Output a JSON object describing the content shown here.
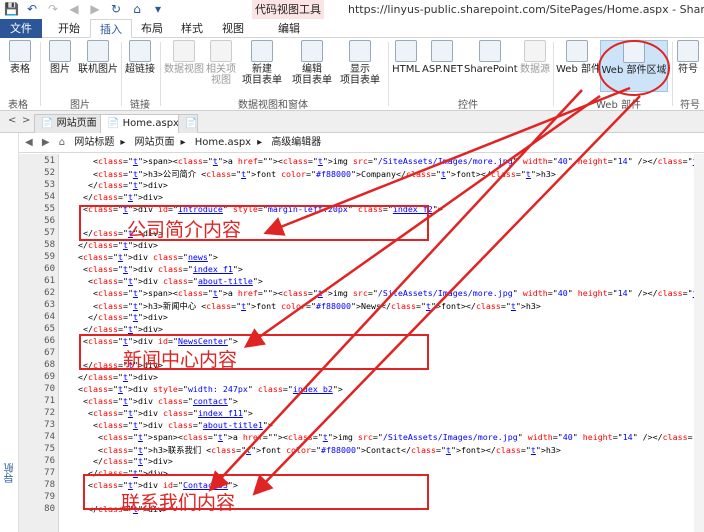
{
  "window": {
    "context_tab": "代码视图工具",
    "title": "https://linyus-public.sharepoint.com/SitePages/Home.aspx - SharePoint Designer"
  },
  "quick_access": [
    "save-icon",
    "undo-icon",
    "redo-icon",
    "back-icon",
    "forward-icon",
    "refresh-icon",
    "home-icon",
    "chevron-down-icon"
  ],
  "tabs": [
    "文件",
    "开始",
    "插入",
    "布局",
    "样式",
    "视图",
    "编辑"
  ],
  "ribbon": {
    "buttons": [
      "表格",
      "图片",
      "联机图片",
      "超链接",
      "数据视图",
      "相关项\n视图",
      "新建\n项目表单",
      "编辑\n项目表单",
      "显示\n项目表单",
      "HTML",
      "ASP.NET",
      "SharePoint",
      "数据源",
      "Web 部件",
      "Web 部件区域",
      "符号"
    ],
    "groups": [
      "表格",
      "图片",
      "链接",
      "数据视图和窗体",
      "控件",
      "Web 部件",
      "符号"
    ]
  },
  "doc_tabs": [
    "网站页面",
    "Home.aspx"
  ],
  "breadcrumb": [
    "网站标题",
    "网站页面",
    "Home.aspx",
    "高级编辑器"
  ],
  "nav_label": "导航",
  "code_lines": [
    {
      "n": "51",
      "t": "      <span><a href=\"\"><img src=\"/SiteAssets/Images/more.jpg\" width=\"40\" height=\"14\" /></a></span>"
    },
    {
      "n": "52",
      "t": "      <h3>公司简介 <font color=\"#f88000\">Company</font></h3>"
    },
    {
      "n": "53",
      "t": "     </div>"
    },
    {
      "n": "54",
      "t": "    </div>"
    },
    {
      "n": "55",
      "t": "    <div id=\"Introduce\" style=\"margin-left:20px\" class=\"index f2\">"
    },
    {
      "n": "56",
      "t": ""
    },
    {
      "n": "57",
      "t": "    </div>"
    },
    {
      "n": "58",
      "t": "   </div>"
    },
    {
      "n": "59",
      "t": "   <div class=\"news\">"
    },
    {
      "n": "60",
      "t": "    <div class=\"index f1\">"
    },
    {
      "n": "61",
      "t": "     <div class=\"about-title\">"
    },
    {
      "n": "62",
      "t": "      <span><a href=\"\"><img src=\"/SiteAssets/Images/more.jpg\" width=\"40\" height=\"14\" /></a></span>"
    },
    {
      "n": "63",
      "t": "      <h3>新闻中心 <font color=\"#f88000\">News</font></h3>"
    },
    {
      "n": "64",
      "t": "     </div>"
    },
    {
      "n": "65",
      "t": "    </div>"
    },
    {
      "n": "66",
      "t": "    <div id=\"NewsCenter\">"
    },
    {
      "n": "67",
      "t": ""
    },
    {
      "n": "68",
      "t": "    </div>"
    },
    {
      "n": "69",
      "t": "   </div>"
    },
    {
      "n": "70",
      "t": "   <div style=\"width: 247px\" class=\"index b2\">"
    },
    {
      "n": "71",
      "t": "    <div class=\"contact\">"
    },
    {
      "n": "72",
      "t": "     <div class=\"index f11\">"
    },
    {
      "n": "73",
      "t": "      <div class=\"about-title1\">"
    },
    {
      "n": "74",
      "t": "       <span><a href=\"\"><img src=\"/SiteAssets/Images/more.jpg\" width=\"40\" height=\"14\" /></a></span>"
    },
    {
      "n": "75",
      "t": "       <h3>联系我们 <font color=\"#f88000\">Contact</font></h3>"
    },
    {
      "n": "76",
      "t": "      </div>"
    },
    {
      "n": "77",
      "t": "     </div>"
    },
    {
      "n": "78",
      "t": "     <div id=\"ContactUS\">"
    },
    {
      "n": "79",
      "t": ""
    },
    {
      "n": "80",
      "t": "     </div>"
    }
  ],
  "annotations": [
    "公司简介内容",
    "新闻中心内容",
    "联系我们内容"
  ],
  "colors": {
    "accent": "#2b579a",
    "annotation": "#e02424",
    "tag": "#8b0000",
    "attr": "#ff0000",
    "value": "#0000ff"
  }
}
